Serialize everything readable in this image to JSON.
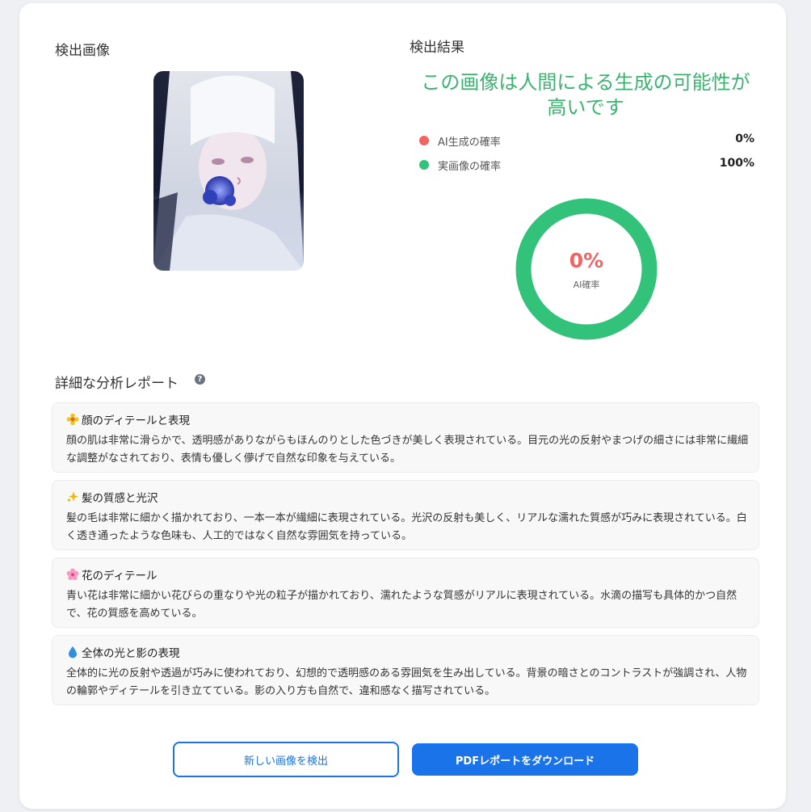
{
  "left_panel": {
    "title": "検出画像"
  },
  "right_panel": {
    "title": "検出結果",
    "verdict": "この画像は人間による生成の可能性が高いです",
    "probabilities": [
      {
        "label": "AI生成の確率",
        "value": "0%",
        "color": "#f06464"
      },
      {
        "label": "実画像の確率",
        "value": "100%",
        "color": "#33c27a"
      }
    ],
    "gauge": {
      "ai_fraction": 0.0,
      "text": "0%",
      "caption": "AI確率",
      "ring_color": "#33c27a",
      "ai_color": "#f06464"
    }
  },
  "report": {
    "title": "詳細な分析レポート",
    "help_icon": "?",
    "items": [
      {
        "icon": "sparkle-flower-icon",
        "title": "顔のディテールと表現",
        "body": "顔の肌は非常に滑らかで、透明感がありながらもほんのりとした色づきが美しく表現されている。目元の光の反射やまつげの細さには非常に繊細な調整がなされており、表情も優しく儚げで自然な印象を与えている。"
      },
      {
        "icon": "sparkles-icon",
        "title": "髪の質感と光沢",
        "body": "髪の毛は非常に細かく描かれており、一本一本が繊細に表現されている。光沢の反射も美しく、リアルな濡れた質感が巧みに表現されている。白く透き通ったような色味も、人工的ではなく自然な雰囲気を持っている。"
      },
      {
        "icon": "cherry-blossom-icon",
        "title": "花のディテール",
        "body": "青い花は非常に細かい花びらの重なりや光の粒子が描かれており、濡れたような質感がリアルに表現されている。水滴の描写も具体的かつ自然で、花の質感を高めている。"
      },
      {
        "icon": "droplet-icon",
        "title": "全体の光と影の表現",
        "body": "全体的に光の反射や透過が巧みに使われており、幻想的で透明感のある雰囲気を生み出している。背景の暗さとのコントラストが強調され、人物の輪郭やディテールを引き立てている。影の入り方も自然で、違和感なく描写されている。"
      }
    ]
  },
  "actions": {
    "new_detect": "新しい画像を検出",
    "download_pdf": "PDFレポートをダウンロード"
  },
  "colors": {
    "accent": "#1a73e8",
    "success": "#3cb371",
    "danger": "#f06464"
  }
}
